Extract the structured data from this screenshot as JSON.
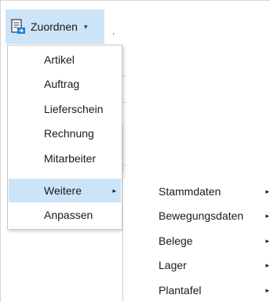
{
  "toolbar": {
    "zuordnen_label": "Zuordnen",
    "caret": "▾",
    "dot": "."
  },
  "menu": {
    "items": [
      {
        "label": "Artikel"
      },
      {
        "label": "Auftrag"
      },
      {
        "label": "Lieferschein"
      },
      {
        "label": "Rechnung"
      },
      {
        "label": "Mitarbeiter"
      },
      {
        "label": "Weitere",
        "has_submenu": true
      },
      {
        "label": "Anpassen"
      }
    ]
  },
  "submenu": {
    "items": [
      {
        "label": "Stammdaten"
      },
      {
        "label": "Bewegungsdaten"
      },
      {
        "label": "Belege"
      },
      {
        "label": "Lager"
      },
      {
        "label": "Plantafel"
      }
    ]
  },
  "arrow_glyph": "▸",
  "colors": {
    "highlight": "#cce4f7",
    "icon_accent": "#1e7fd4"
  }
}
